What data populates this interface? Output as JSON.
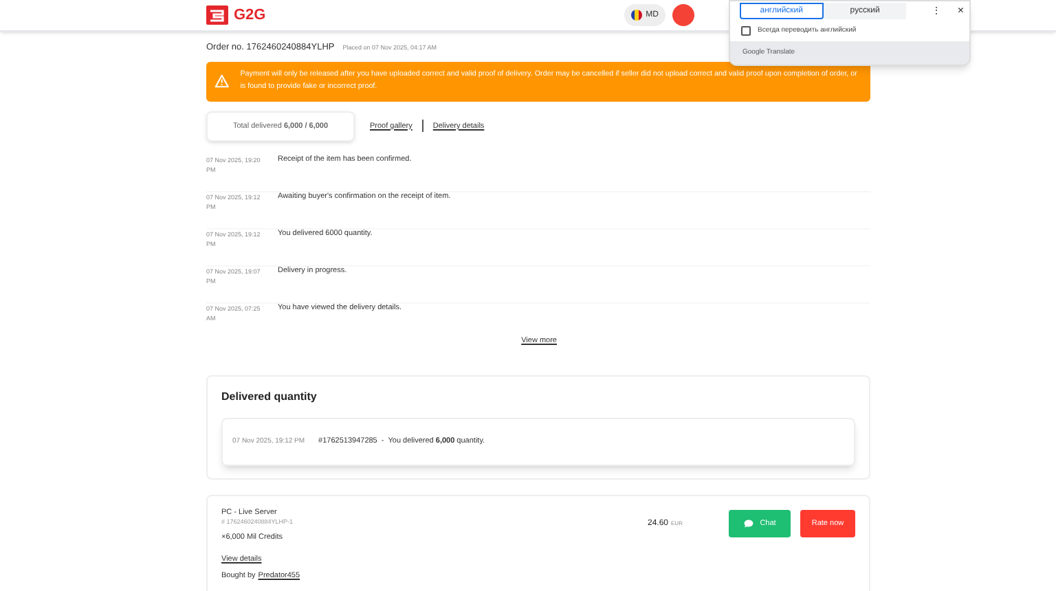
{
  "header": {
    "logo": "G2G",
    "region": "MD"
  },
  "translate_popup": {
    "tabs": [
      {
        "label": "английский",
        "selected": true
      },
      {
        "label": "русский",
        "selected": false
      }
    ],
    "menu": "⋮",
    "close": "×",
    "always_translate": {
      "label": "Всегда переводить английский",
      "checked": false
    },
    "footer": "Google Translate"
  },
  "order": {
    "number": "Order no. 1762460240884YLHP",
    "placed": "Placed on 07 Nov 2025, 04:17 AM"
  },
  "warning": "Payment will only be released after you have uploaded correct and valid proof of delivery. Order may be cancelled if seller did not upload correct and valid proof upon completion of order, or is found to provide fake or incorrect proof.",
  "total_delivered": "Total delivered **6,000 / 6,000**",
  "links": [
    "Proof gallery",
    "Delivery details"
  ],
  "timeline": [
    {
      "time": "07 Nov 2025, 19:20 PM",
      "text": "Receipt of the item has been confirmed."
    },
    {
      "time": "07 Nov 2025, 19:12 PM",
      "text": "Awaiting buyer's confirmation on the receipt of item."
    },
    {
      "time": "07 Nov 2025, 19:12 PM",
      "text": "You delivered 6000 quantity."
    },
    {
      "time": "07 Nov 2025, 19:07 PM",
      "text": "Delivery in progress."
    },
    {
      "time": "07 Nov 2025, 07:25 AM",
      "text": "You have viewed the delivery details."
    }
  ],
  "view_more": "View more",
  "delivered_quantity": {
    "title": "Delivered quantity",
    "entries": [
      {
        "time": "07 Nov 2025, 19:12 PM",
        "id": "#1762513947285",
        "separator": "-",
        "text": "You delivered **6,000** quantity."
      }
    ]
  },
  "item": {
    "server": "PC - Live Server",
    "sub_id": "# 1762460240884YLHP-1",
    "price": "24.60",
    "currency": "EUR",
    "quantity": "×6,000 Mil Credits",
    "view_details": "View details",
    "bought_by": "Bought by",
    "buyer": "Predator455",
    "buttons": [
      "Chat",
      "Rate now"
    ]
  }
}
